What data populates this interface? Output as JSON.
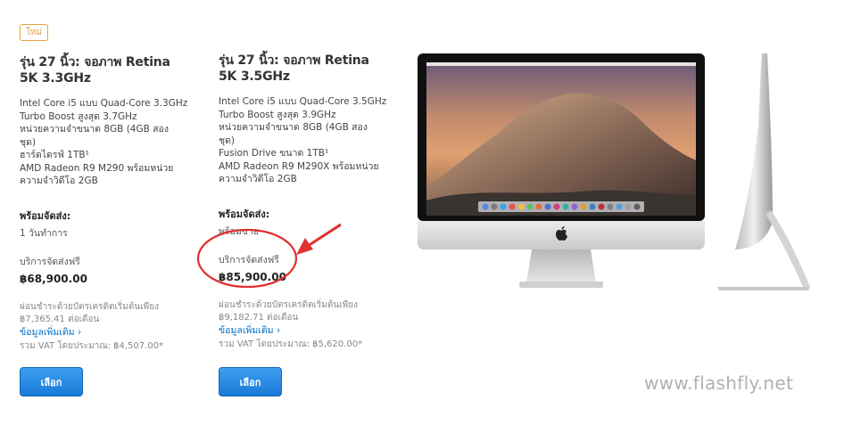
{
  "badge": "ใหม่",
  "products": [
    {
      "title_line1": "รุ่น 27 นิ้ว: จอภาพ Retina",
      "title_line2": "5K 3.3GHz",
      "specs": [
        "Intel Core i5 แบบ Quad-Core 3.3GHz",
        "Turbo Boost สูงสุด 3.7GHz",
        "หน่วยความจำขนาด 8GB (4GB สอง",
        "ชุด)",
        "ฮาร์ดไดรฟ์ 1TB¹",
        "AMD Radeon R9 M290 พร้อมหน่วย",
        "ความจำวิดีโอ 2GB"
      ],
      "availability_label": "พร้อมจัดส่ง:",
      "availability_value": "1 วันทำการ",
      "shipping": "บริการจัดส่งฟรี",
      "price": "฿68,900.00",
      "finance_line1": "ผ่อนชำระด้วยบัตรเครดิตเริ่มต้นเพียง",
      "finance_line2": "฿7,365.41 ต่อเดือน",
      "more_info": "ข้อมูลเพิ่มเติม",
      "vat": "รวม VAT โดยประมาณ: ฿4,507.00*",
      "button": "เลือก"
    },
    {
      "title_line1": "รุ่น 27 นิ้ว: จอภาพ Retina",
      "title_line2": "5K 3.5GHz",
      "specs": [
        "Intel Core i5 แบบ Quad-Core 3.5GHz",
        "Turbo Boost สูงสุด 3.9GHz",
        "หน่วยความจำขนาด 8GB (4GB สอง",
        "ชุด)",
        "Fusion Drive ขนาด 1TB¹",
        "AMD Radeon R9 M290X พร้อมหน่วย",
        "ความจำวิดีโอ 2GB"
      ],
      "availability_label": "พร้อมจัดส่ง:",
      "availability_value": "พร้อมขาย",
      "shipping": "บริการจัดส่งฟรี",
      "price": "฿85,900.00",
      "finance_line1": "ผ่อนชำระด้วยบัตรเครดิตเริ่มต้นเพียง",
      "finance_line2": "฿9,182.71 ต่อเดือน",
      "more_info": "ข้อมูลเพิ่มเติม",
      "vat": "รวม VAT โดยประมาณ: ฿5,620.00*",
      "button": "เลือก"
    }
  ],
  "watermark": "www.flashfly.net",
  "colors": {
    "accent_link": "#0070c9",
    "button": "#1a7ad8",
    "badge": "#e8a33d",
    "annotation": "#e03030"
  }
}
